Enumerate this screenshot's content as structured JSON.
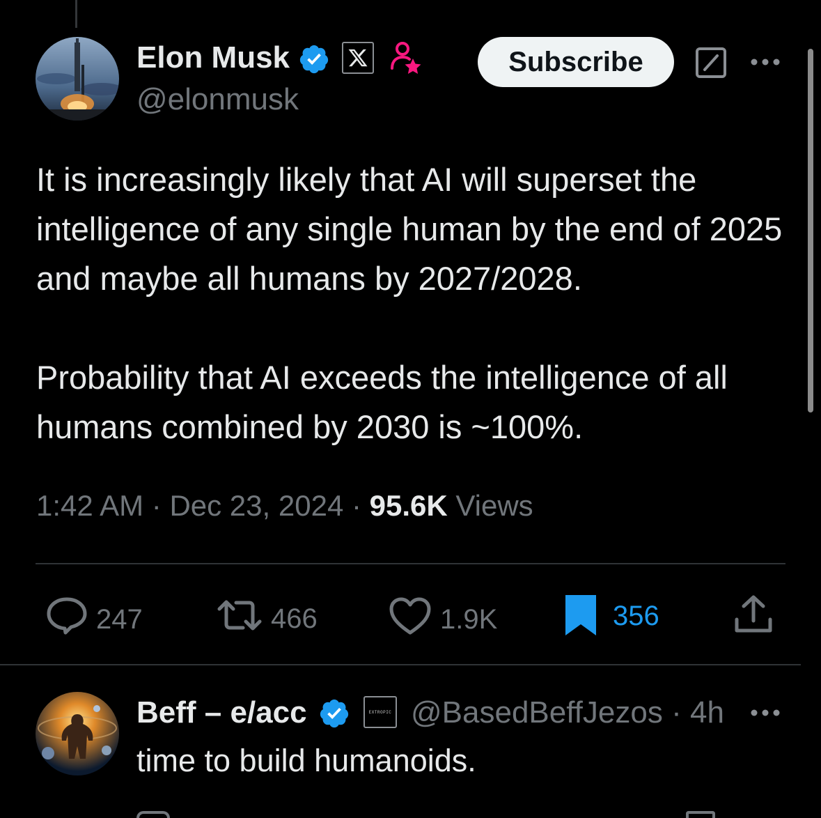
{
  "tweet": {
    "author_name": "Elon Musk",
    "author_handle": "@elonmusk",
    "subscribe_label": "Subscribe",
    "text_p1": "It is increasingly likely that AI will superset the intelligence of any single human by the end of 2025 and maybe all humans by 2027/2028.",
    "text_p2": "Probability that AI exceeds the intelligence of all humans combined by 2030 is ~100%.",
    "time": "1:42 AM",
    "date": "Dec 23, 2024",
    "views_count": "95.6K",
    "views_label": "Views",
    "separator": "·",
    "actions": {
      "replies": "247",
      "reposts": "466",
      "likes": "1.9K",
      "bookmarks": "356"
    }
  },
  "reply": {
    "author_name": "Beff – e/acc",
    "affiliate_badge_text": "EXTROPIC",
    "author_handle": "@BasedBeffJezos",
    "time_ago": "4h",
    "text": "time to build humanoids."
  },
  "colors": {
    "background": "#000000",
    "text_primary": "#e7e9ea",
    "text_secondary": "#71767b",
    "verified_blue": "#1d9bf0",
    "subscriber_badge_pink": "#f91880"
  },
  "icons": {
    "verified": "verified-badge-icon",
    "x_affiliate": "x-logo-icon",
    "subscriber": "subscriber-star-icon",
    "grok": "grok-icon",
    "more": "more-icon",
    "reply": "reply-icon",
    "repost": "repost-icon",
    "like": "heart-icon",
    "bookmark": "bookmark-icon",
    "share": "share-icon"
  }
}
